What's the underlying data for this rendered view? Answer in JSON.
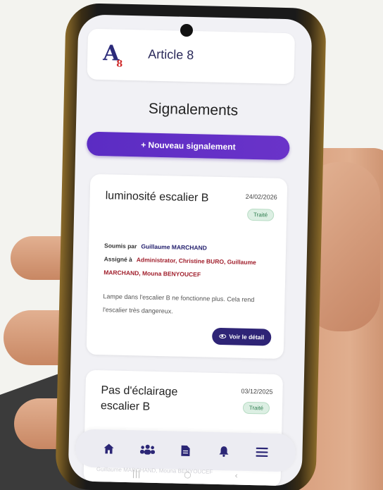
{
  "app": {
    "logo_letter": "A",
    "logo_sub": "8",
    "title": "Article 8"
  },
  "page": {
    "title": "Signalements",
    "new_button": "+ Nouveau signalement"
  },
  "cards": [
    {
      "title": "luminosité escalier B",
      "date": "24/02/2026",
      "status": "Traité",
      "submitted_label": "Soumis par",
      "submitted_by": "Guillaume MARCHAND",
      "assigned_label": "Assigné à",
      "assigned_to": "Administrator, Christine BURO, Guillaume MARCHAND, Mouna BENYOUCEF",
      "description": "Lampe dans l'escalier B ne fonctionne plus. Cela rend l'escalier très dangereux.",
      "detail_button": "Voir le détail"
    },
    {
      "title": "Pas d'éclairage escalier B",
      "date": "03/12/2025",
      "status": "Traité"
    }
  ],
  "navbar": {
    "icons": [
      "home-icon",
      "users-icon",
      "document-icon",
      "bell-icon",
      "menu-icon"
    ]
  },
  "ghost_text": "Guillaume MARCHAND, Mouna BENYOUCEF",
  "colors": {
    "primary": "#5b2cc3",
    "navy": "#2e2476",
    "status_green": "#2e7d4f"
  }
}
